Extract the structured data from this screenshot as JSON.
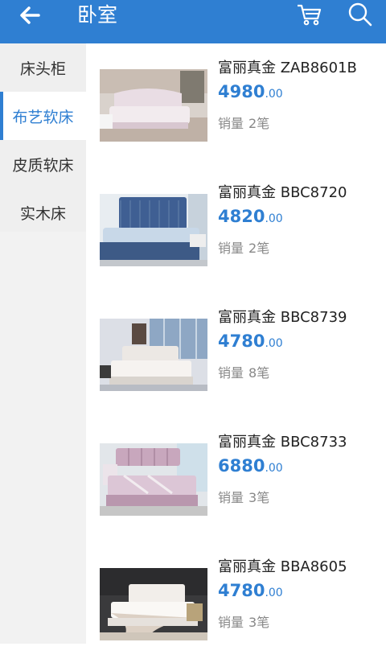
{
  "header": {
    "title": "卧室",
    "icons": [
      "back-arrow-icon",
      "cart-icon",
      "search-icon"
    ]
  },
  "colors": {
    "accent": "#2f7fd2",
    "sidebar_bg": "#efefef",
    "muted_text": "#888888"
  },
  "sidebar": {
    "items": [
      {
        "label": "床头柜",
        "active": false
      },
      {
        "label": "布艺软床",
        "active": true
      },
      {
        "label": "皮质软床",
        "active": false
      },
      {
        "label": "实木床",
        "active": false
      }
    ]
  },
  "products": [
    {
      "name": "富丽真金 ZAB8601B",
      "price_int": "4980",
      "price_dec": ".00",
      "sales_label": "销量",
      "sales_value": "2笔"
    },
    {
      "name": "富丽真金 BBC8720",
      "price_int": "4820",
      "price_dec": ".00",
      "sales_label": "销量",
      "sales_value": "2笔"
    },
    {
      "name": "富丽真金 BBC8739",
      "price_int": "4780",
      "price_dec": ".00",
      "sales_label": "销量",
      "sales_value": "8笔"
    },
    {
      "name": "富丽真金 BBC8733",
      "price_int": "6880",
      "price_dec": ".00",
      "sales_label": "销量",
      "sales_value": "3笔"
    },
    {
      "name": "富丽真金 BBA8605",
      "price_int": "4780",
      "price_dec": ".00",
      "sales_label": "销量",
      "sales_value": "3笔"
    }
  ]
}
